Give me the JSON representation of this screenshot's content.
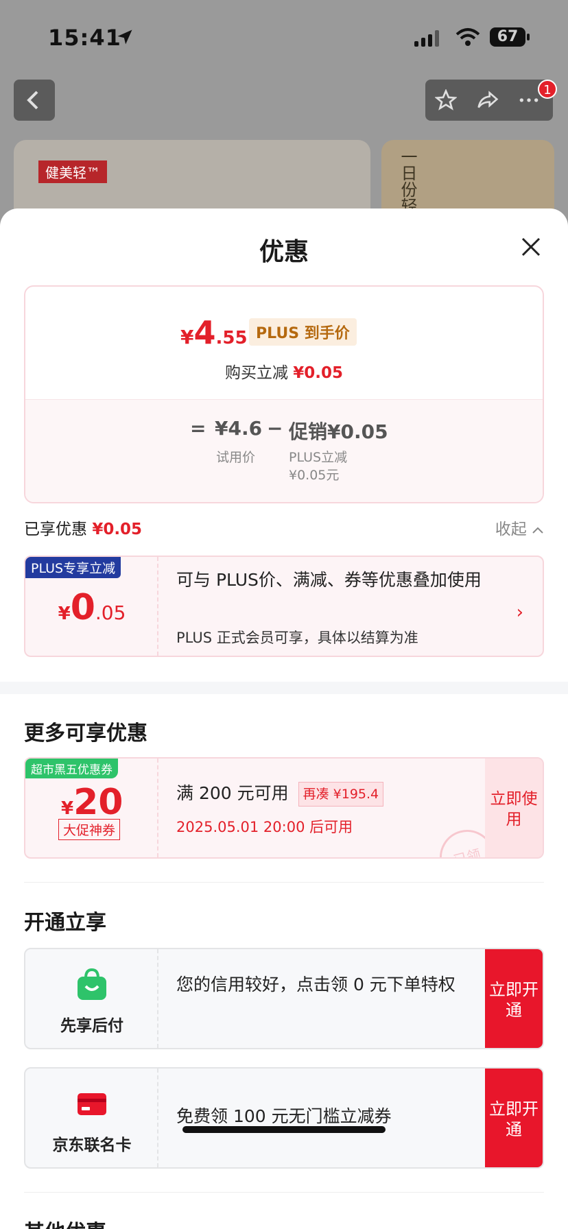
{
  "status_bar": {
    "time": "15:41",
    "battery": "67"
  },
  "top_bar": {
    "badge_count": "1"
  },
  "background": {
    "brand_label": "健美轻™",
    "product_text": "一日份轻"
  },
  "sheet": {
    "title": "优惠",
    "price_summary": {
      "currency": "¥",
      "price_int": "4",
      "price_dec": ".55",
      "plus_tag": "PLUS 到手价",
      "reduce_label": "购买立减",
      "reduce_value": "¥0.05",
      "eq_sign": "=",
      "trial_price": "¥4.6",
      "trial_label": "试用价",
      "minus_sign": "−",
      "promo_label": "促销¥0.05",
      "plus_reduce_label": "PLUS立减",
      "plus_reduce_value": "¥0.05元"
    },
    "enjoyed": {
      "label": "已享优惠",
      "value": "¥0.05",
      "collapse": "收起"
    },
    "plus_card": {
      "tag": "PLUS专享立减",
      "currency": "¥",
      "amount_int": "0",
      "amount_dec": ".05",
      "title": "可与 PLUS价、满减、券等优惠叠加使用",
      "subtitle": "PLUS 正式会员可享，具体以结算为准"
    },
    "more_section": {
      "title": "更多可享优惠",
      "coupon": {
        "tag": "超市黑五优惠券",
        "currency": "¥",
        "amount": "20",
        "type": "大促神券",
        "condition": "满 200 元可用",
        "recou": "再凑 ¥195.4",
        "time": "2025.05.01 20:00 后可用",
        "button": "立即使用",
        "stamp": "已领"
      }
    },
    "open_section": {
      "title": "开通立享",
      "items": [
        {
          "label": "先享后付",
          "text": "您的信用较好，点击领 0 元下单特权",
          "button": "立即开通"
        },
        {
          "label": "京东联名卡",
          "text": "免费领 100 元无门槛立减券",
          "button": "立即开通"
        }
      ]
    },
    "other_section": {
      "title": "其他优惠"
    }
  },
  "colors": {
    "accent": "#e3202a",
    "plus_blue": "#233b9f",
    "green": "#2ec36a"
  }
}
